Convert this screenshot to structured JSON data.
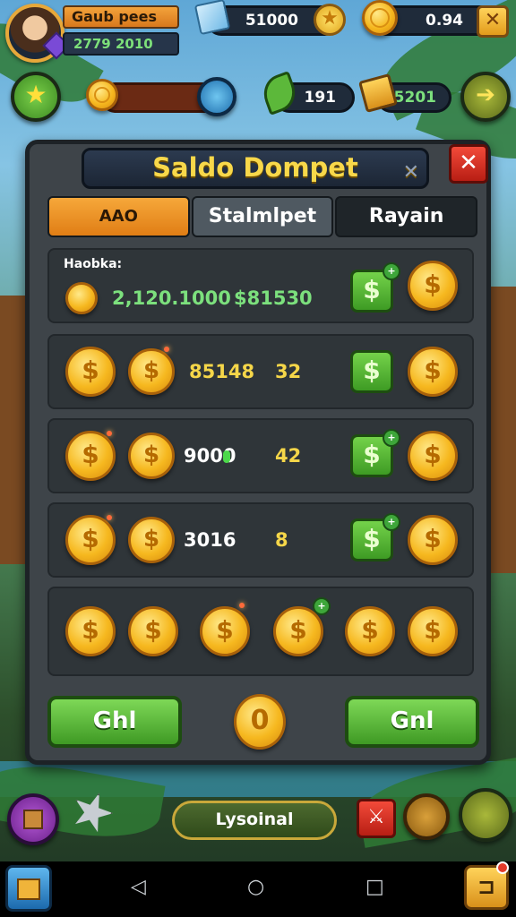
{
  "profile": {
    "name": "Gaub pees",
    "sub_value": "2779 2010"
  },
  "top_resources": {
    "gems_value": "51000",
    "coins_value": "0.94"
  },
  "second_row": {
    "boost_value": "191",
    "chest_value": "5201"
  },
  "modal": {
    "title": "Saldo Dompet",
    "tabs": [
      {
        "label": "AAO"
      },
      {
        "label": "Stalmlpet"
      },
      {
        "label": "Rayain"
      }
    ],
    "rows": [
      {
        "label": "Haobka:",
        "amount": "2,120.1000",
        "price": "$81530"
      },
      {
        "amount": "85148",
        "count": "32"
      },
      {
        "amount": "9000",
        "count": "42"
      },
      {
        "amount": "3016",
        "count": "8"
      }
    ],
    "left_button": "Ghl",
    "right_button": "Gnl",
    "center_coin": "0"
  },
  "bottom": {
    "special_label": "Lysoinal"
  },
  "colors": {
    "accent_gold": "#f8d84a",
    "accent_green": "#7ce07d",
    "modal_bg": "#3e4449",
    "button_green": "#3f9a24",
    "close_red": "#d8301f"
  },
  "icons": [
    "star-icon",
    "ice-cube-icon",
    "coin-icon",
    "dollar-icon",
    "arrow-right-icon",
    "leaf-icon",
    "gift-box-icon",
    "shield-icon",
    "scroll-icon",
    "close-icon",
    "back-icon",
    "home-icon",
    "recent-icon"
  ]
}
